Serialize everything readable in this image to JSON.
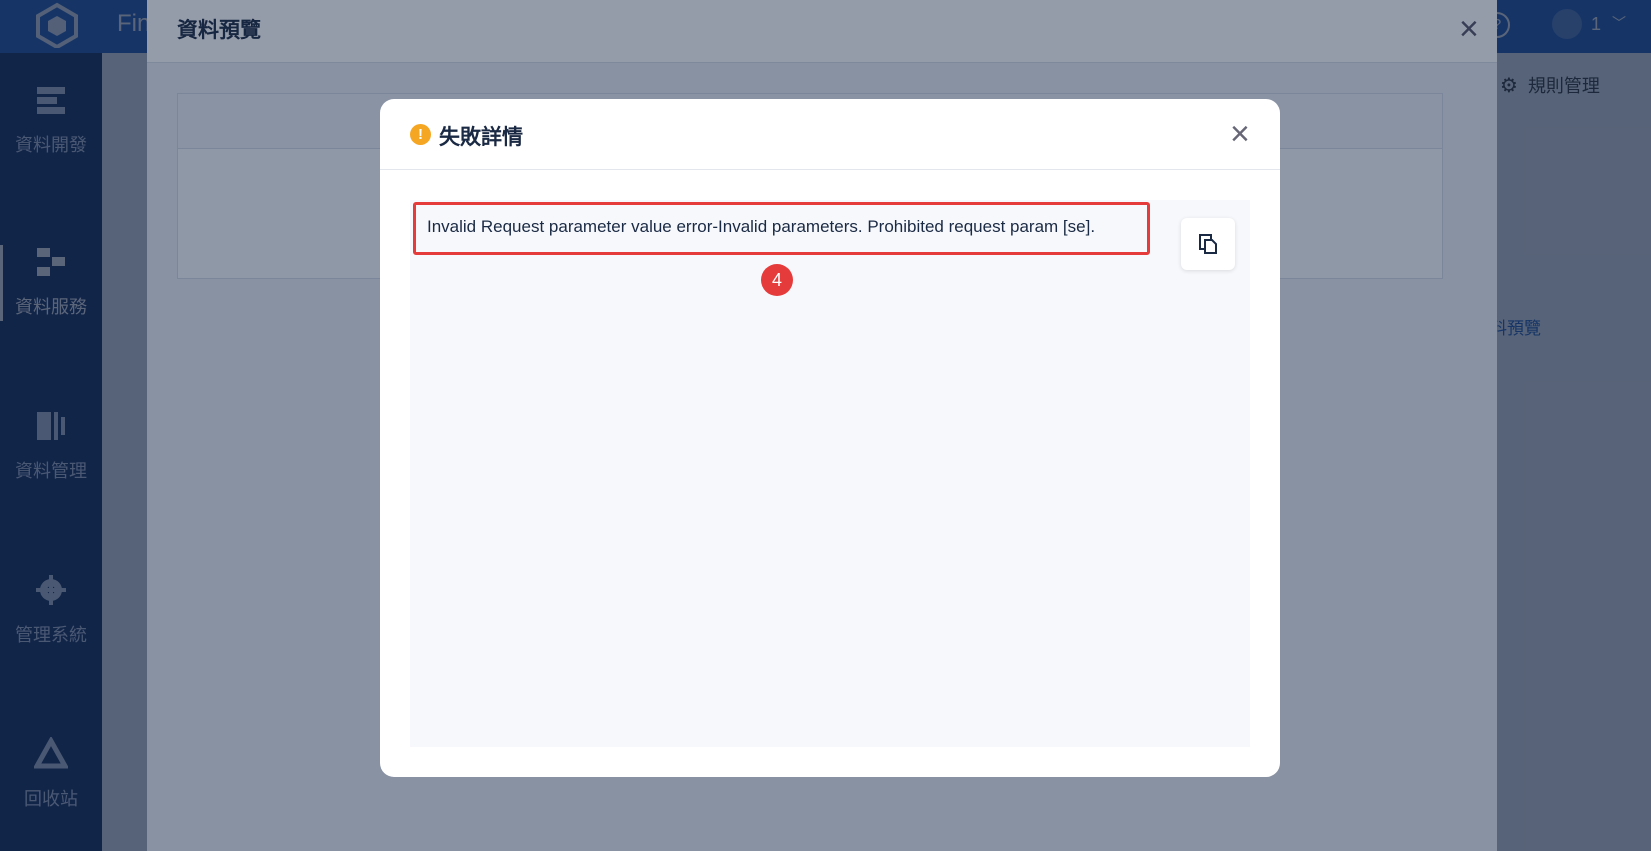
{
  "app": {
    "name": "Fin"
  },
  "topbar": {
    "help_symbol": "?",
    "user_name": "1",
    "user_chevron": "﹀"
  },
  "sidebar": {
    "items": [
      {
        "label": "資料開發",
        "icon": "data-dev-icon"
      },
      {
        "label": "資料服務",
        "icon": "data-service-icon",
        "active": true
      },
      {
        "label": "資料管理",
        "icon": "data-manage-icon"
      },
      {
        "label": "管理系統",
        "icon": "gear-icon"
      },
      {
        "label": "回收站",
        "icon": "recycle-icon"
      }
    ]
  },
  "main": {
    "rules_label": "規則管理",
    "preview_link": "料預覽"
  },
  "outer_modal": {
    "title": "資料預覽",
    "close_symbol": "×"
  },
  "dialog": {
    "title": "失敗詳情",
    "warn_symbol": "!",
    "close_symbol": "×",
    "error_message": "Invalid Request parameter value error-Invalid parameters. Prohibited request param [se].",
    "badge": "4"
  },
  "colors": {
    "brand": "#1c5fc0",
    "sidebar": "#0e2a5e",
    "warning": "#f5a623",
    "highlight": "#e63b3b"
  }
}
